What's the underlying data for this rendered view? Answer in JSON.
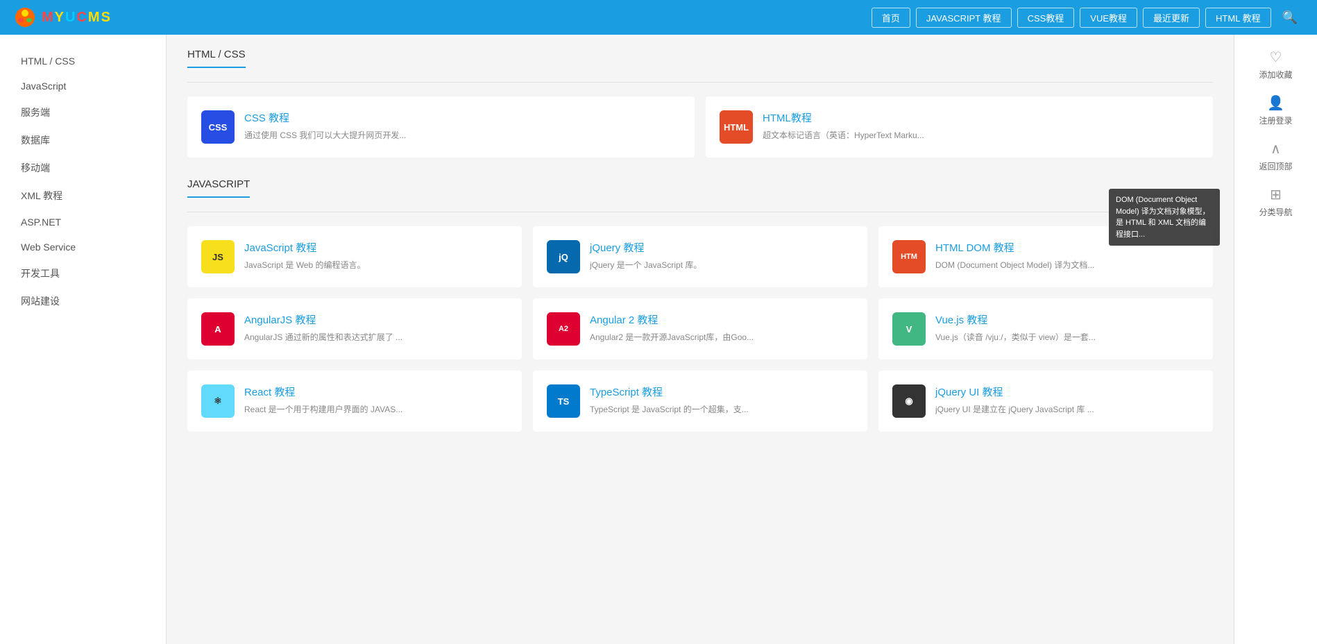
{
  "header": {
    "logo_text": "MYUCMS",
    "nav_items": [
      {
        "label": "首页",
        "key": "home"
      },
      {
        "label": "JAVASCRIPT 教程",
        "key": "javascript"
      },
      {
        "label": "CSS教程",
        "key": "css"
      },
      {
        "label": "VUE教程",
        "key": "vue"
      },
      {
        "label": "最近更新",
        "key": "recent"
      },
      {
        "label": "HTML 教程",
        "key": "html"
      }
    ]
  },
  "sidebar": {
    "items": [
      {
        "label": "HTML / CSS",
        "key": "html-css"
      },
      {
        "label": "JavaScript",
        "key": "javascript"
      },
      {
        "label": "服务端",
        "key": "server"
      },
      {
        "label": "数据库",
        "key": "database"
      },
      {
        "label": "移动端",
        "key": "mobile"
      },
      {
        "label": "XML 教程",
        "key": "xml"
      },
      {
        "label": "ASP.NET",
        "key": "aspnet"
      },
      {
        "label": "Web Service",
        "key": "webservice"
      },
      {
        "label": "开发工具",
        "key": "devtools"
      },
      {
        "label": "网站建设",
        "key": "website"
      }
    ]
  },
  "sections": [
    {
      "key": "html-css",
      "title": "HTML / CSS",
      "cols": 2,
      "cards": [
        {
          "key": "css",
          "title": "CSS 教程",
          "desc": "通过使用 CSS 我们可以大大提升网页开发...",
          "icon_label": "CSS",
          "icon_class": "icon-css"
        },
        {
          "key": "html",
          "title": "HTML教程",
          "desc": "超文本标记语言（英语：HyperText Marku...",
          "icon_label": "HTML",
          "icon_class": "icon-html"
        }
      ]
    },
    {
      "key": "javascript",
      "title": "JAVASCRIPT",
      "cols": 3,
      "cards": [
        {
          "key": "javascript-tutorial",
          "title": "JavaScript 教程",
          "desc": "JavaScript 是 Web 的编程语言。",
          "icon_label": "JS",
          "icon_class": "icon-js"
        },
        {
          "key": "jquery",
          "title": "jQuery 教程",
          "desc": "jQuery 是一个 JavaScript 库。",
          "icon_label": "jQ",
          "icon_class": "icon-jquery"
        },
        {
          "key": "html-dom",
          "title": "HTML DOM 教程",
          "desc": "DOM (Document Object Model) 译为文档...",
          "icon_label": "HTM",
          "icon_class": "icon-dom",
          "has_tooltip": true,
          "tooltip_text": "DOM (Document Object Model) 译为文档对象模型，是 HTML 和 XML 文档的编程接口..."
        },
        {
          "key": "angularjs",
          "title": "AngularJS 教程",
          "desc": "AngularJS 通过新的属性和表达式扩展了 ...",
          "icon_label": "A",
          "icon_class": "icon-angular"
        },
        {
          "key": "angular2",
          "title": "Angular 2 教程",
          "desc": "Angular2 是一款开源JavaScript库，由Goo...",
          "icon_label": "A2",
          "icon_class": "icon-angular2"
        },
        {
          "key": "vuejs",
          "title": "Vue.js 教程",
          "desc": "Vue.js（读音 /vjuː/，类似于 view）是一套...",
          "icon_label": "V",
          "icon_class": "icon-vue"
        },
        {
          "key": "react",
          "title": "React 教程",
          "desc": "React 是一个用于构建用户界面的 JAVAS...",
          "icon_label": "⚛",
          "icon_class": "icon-react"
        },
        {
          "key": "typescript",
          "title": "TypeScript 教程",
          "desc": "TypeScript 是 JavaScript 的一个超集，支...",
          "icon_label": "TS",
          "icon_class": "icon-ts"
        },
        {
          "key": "jqueryui",
          "title": "jQuery UI 教程",
          "desc": "jQuery UI 是建立在 jQuery JavaScript 库 ...",
          "icon_label": "◉",
          "icon_class": "icon-jqueryui"
        }
      ]
    }
  ],
  "right_actions": [
    {
      "label": "添加收藏",
      "icon": "♡",
      "key": "bookmark"
    },
    {
      "label": "注册登录",
      "icon": "👤",
      "key": "login"
    },
    {
      "label": "返回顶部",
      "icon": "∧",
      "key": "top"
    },
    {
      "label": "分类导航",
      "icon": "⊞",
      "key": "nav"
    }
  ]
}
